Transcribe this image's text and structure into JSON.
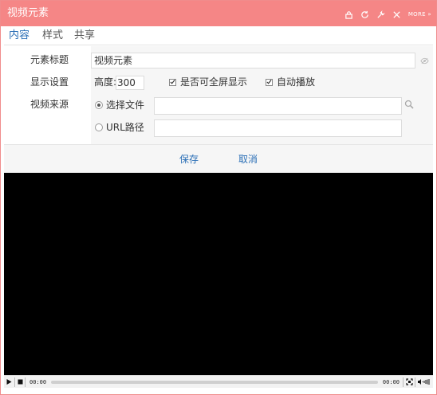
{
  "window": {
    "title": "视频元素",
    "more_label": "MORE »"
  },
  "tabs": [
    {
      "label": "内容"
    },
    {
      "label": "样式"
    },
    {
      "label": "共享"
    }
  ],
  "form": {
    "title_label": "元素标题",
    "title_value": "视频元素",
    "display_label": "显示设置",
    "height_label": "高度:",
    "height_value": "300",
    "fullscreen_label": "是否可全屏显示",
    "fullscreen_checked": true,
    "autoplay_label": "自动播放",
    "autoplay_checked": true,
    "source_label": "视频来源",
    "source_file_label": "选择文件",
    "source_file_value": "",
    "source_url_label": "URL路径",
    "source_url_value": ""
  },
  "actions": {
    "save_label": "保存",
    "cancel_label": "取消"
  },
  "player": {
    "current_time": "00:00",
    "duration": "00:00"
  },
  "colors": {
    "titlebar": "#f58686",
    "link": "#2b6fb6"
  },
  "icons": [
    "lock-icon",
    "refresh-icon",
    "wrench-icon",
    "close-icon",
    "eye-icon",
    "search-icon",
    "play-icon",
    "stop-icon",
    "fullscreen-icon",
    "volume-icon"
  ]
}
